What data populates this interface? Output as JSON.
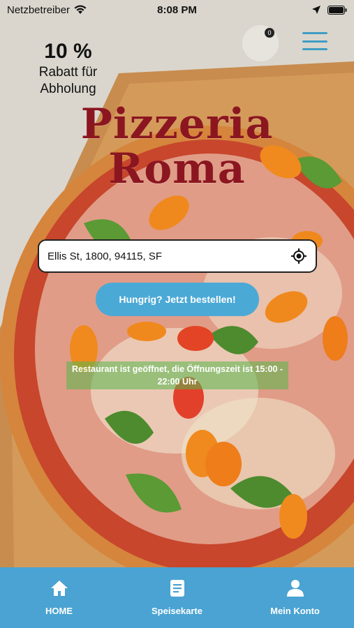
{
  "status_bar": {
    "carrier": "Netzbetreiber",
    "time": "8:08 PM"
  },
  "promo": {
    "percent": "10 %",
    "text": "Rabatt für Abholung"
  },
  "cart": {
    "count": "0"
  },
  "brand": {
    "line1": "Pizzeria",
    "line2": "Roma",
    "color": "#8b1620"
  },
  "address": {
    "value": "Ellis St, 1800, 94115, SF"
  },
  "order_button": {
    "label": "Hungrig? Jetzt bestellen!"
  },
  "open_info": {
    "text": "Restaurant ist geöffnet, die Öffnungszeit ist 15:00 - 22:00 Uhr"
  },
  "bottom_nav": {
    "items": [
      {
        "label": "HOME",
        "icon": "home-icon"
      },
      {
        "label": "Speisekarte",
        "icon": "menu-card-icon"
      },
      {
        "label": "Mein Konto",
        "icon": "user-icon"
      }
    ]
  },
  "colors": {
    "accent": "#4aa3d2",
    "open_banner": "#56b84a"
  }
}
